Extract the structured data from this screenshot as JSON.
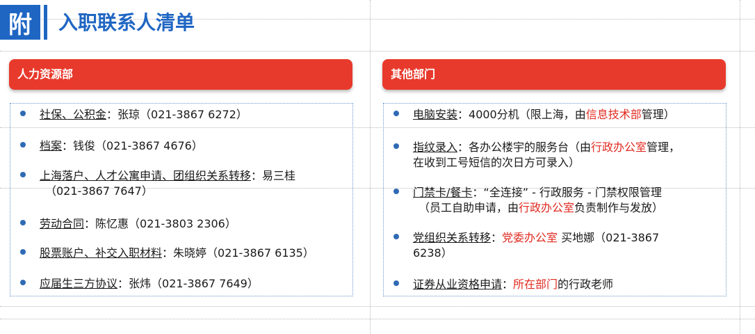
{
  "page": {
    "badge": "附",
    "title": "入职联系人清单"
  },
  "left": {
    "header": "人力资源部",
    "items": [
      {
        "label": "社保、公积金",
        "rest": "：张琼（021-3867 6272）"
      },
      {
        "label": "档案",
        "rest": "：钱俊（021-3867 4676）"
      },
      {
        "label": "上海落户、人才公寓申请、团组织关系转移",
        "rest": "：易三桂",
        "line2": "（021-3867 7647）"
      },
      {
        "label": "劳动合同",
        "rest": "：陈忆惠（021-3803 2306）"
      },
      {
        "label": "股票账户、补交入职材料",
        "rest": "：朱晓婷（021-3867 6135）"
      },
      {
        "label": "应届生三方协议",
        "rest": "：张炜（021-3867 7649）"
      }
    ]
  },
  "right": {
    "header": "其他部门",
    "items": [
      {
        "label": "电脑安装",
        "a": "：4000分机（限上海，由",
        "red": "信息技术部",
        "b": "管理）"
      },
      {
        "label": "指纹录入",
        "a": "：各办公楼宇的服务台（由",
        "red": "行政办公室",
        "b": "管理，",
        "line2": "在收到工号短信的次日方可录入）"
      },
      {
        "label": "门禁卡/餐卡",
        "a": "：“全连接” - 行政服务 - 门禁权限管理",
        "line2a": "（员工自助申请，由",
        "line2red": "行政办公室",
        "line2b": "负责制作与发放）"
      },
      {
        "label": "党组织关系转移",
        "a": "：",
        "red": "党委办公室",
        "b": " 买地娜（021-3867",
        "line2": "6238）"
      },
      {
        "label": "证券从业资格申请",
        "a": "：",
        "red": "所在部门",
        "b": "的行政老师"
      }
    ]
  },
  "colors": {
    "accent_blue": "#1f66c3",
    "header_red": "#e83a2c",
    "highlight_red": "#e02a20",
    "bullet_blue": "#2f6bb5"
  }
}
